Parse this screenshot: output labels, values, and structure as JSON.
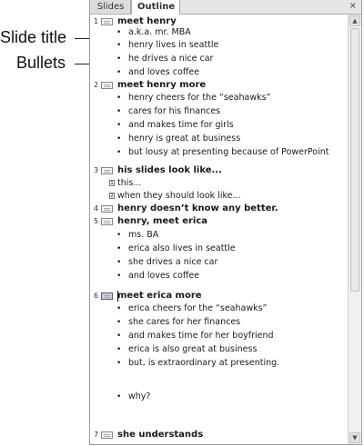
{
  "callouts": {
    "slide_title": "Slide title",
    "bullets": "Bullets"
  },
  "tabs": {
    "slides": "Slides",
    "outline": "Outline"
  },
  "close_symbol": "×",
  "scroll": {
    "up": "▲",
    "down": "▼"
  },
  "bullet_symbol": "•",
  "outline": {
    "s1": {
      "num": "1",
      "title": "meet henry",
      "bullets": [
        "a.k.a. mr. MBA",
        "henry lives in seattle",
        "he drives a nice car",
        "and loves coffee"
      ]
    },
    "s2": {
      "num": "2",
      "title": "meet henry more",
      "bullets": [
        "henry cheers for the “seahawks”",
        "cares for his finances",
        "and makes time for girls",
        "henry is great at business",
        "but lousy at presenting because of PowerPoint"
      ]
    },
    "s3": {
      "num": "3",
      "title": "his slides look like...",
      "subs": [
        {
          "n": "1",
          "text": "this..."
        },
        {
          "n": "2",
          "text": "when they should look like..."
        }
      ]
    },
    "s4": {
      "num": "4",
      "title": "henry doesn’t know any better."
    },
    "s5": {
      "num": "5",
      "title": "henry, meet erica",
      "bullets": [
        "ms. BA",
        "erica also lives in seattle",
        "she drives a nice car",
        "and loves coffee"
      ]
    },
    "s6": {
      "num": "6",
      "title": "meet erica more",
      "bullets": [
        "erica cheers for the “seahawks”",
        "she cares for her finances",
        "and makes time for her boyfriend",
        "erica is also great at business",
        "but, is extraordinary at presenting."
      ],
      "extra_bullet": "why?"
    },
    "s7": {
      "num": "7",
      "title": "she understands"
    }
  }
}
